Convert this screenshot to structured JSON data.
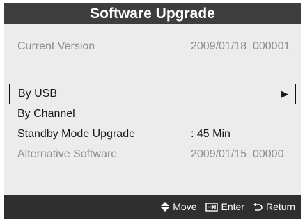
{
  "dialog": {
    "title": "Software Upgrade"
  },
  "info": {
    "current_version_label": "Current Version",
    "current_version_value": "2009/01/18_000001"
  },
  "menu": {
    "by_usb_label": "By USB",
    "by_usb_arrow": "▶",
    "by_channel_label": "By Channel",
    "standby_label": "Standby Mode Upgrade",
    "standby_value": ": 45 Min",
    "alternative_label": "Alternative Software",
    "alternative_value": "2009/01/15_00000"
  },
  "footer": {
    "move_label": "Move",
    "move_icon": "up-down-arrow-icon",
    "enter_label": "Enter",
    "enter_icon": "enter-icon",
    "return_label": "Return",
    "return_icon": "return-icon"
  },
  "colors": {
    "titlebar": "#3e3e3e",
    "panel": "#ececec",
    "footer": "#2f2f2f",
    "muted_text": "#8d8d8d"
  }
}
